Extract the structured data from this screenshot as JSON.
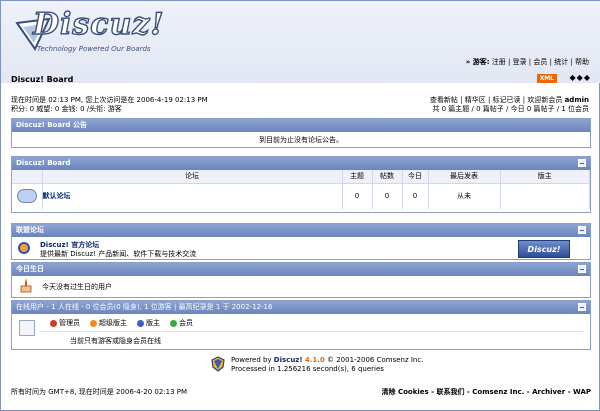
{
  "header": {
    "logo_text": "Discuz!",
    "logo_tagline": "Technology Powered Our Boards",
    "toplinks_prefix": "» 游客:",
    "toplinks": "注册 | 登录 | 会员 | 统计 | 帮助",
    "board_title": "Discuz! Board",
    "xml_label": "XML",
    "arrows": "◆◆◆"
  },
  "info": {
    "left_line1": "现在时间是 02:13 PM, 您上次访问是在 2006-4-19 02:13 PM",
    "left_line2": "积分: 0 威望: 0 金钱: 0 /头衔: 游客",
    "right_line1_links": "查看新帖 | 精华区 | 标记已读 | 欢迎新会员",
    "right_line1_user": "admin",
    "right_line2": "共 0 篇主题 / 0 篇帖子 / 今日 0 篇帖子 / 1 位会员"
  },
  "announce": {
    "title": "Discuz! Board 公告",
    "text": "到目前为止没有论坛公告。"
  },
  "forums": {
    "title": "Discuz! Board",
    "columns": [
      "论坛",
      "主题",
      "帖数",
      "今日",
      "最后发表",
      "版主"
    ],
    "rows": [
      {
        "name": "默认论坛",
        "topics": "0",
        "posts": "0",
        "today": "0",
        "last": "从未",
        "mod": ""
      }
    ]
  },
  "league": {
    "title": "联盟论坛",
    "name": "Discuz! 官方论坛",
    "desc": "提供最新 Discuz! 产品新闻、软件下载与技术交流",
    "banner": "Discuz!"
  },
  "birthday": {
    "title": "今日生日",
    "text": "今天没有过生日的用户"
  },
  "online": {
    "title": "在线用户",
    "summary": "- 1 人在线 - 0 位会员(0 隐身), 1 位游客 | 最高纪录是 1 于 2002-12-16",
    "legend": [
      {
        "label": "管理员",
        "color": "#d23a2a"
      },
      {
        "label": "超级版主",
        "color": "#f08a1a"
      },
      {
        "label": "版主",
        "color": "#3a62c4"
      },
      {
        "label": "会员",
        "color": "#3aa83a"
      }
    ],
    "none_text": "当前只有游客或隐身会员在线"
  },
  "powered": {
    "line1_prefix": "Powered by ",
    "line1_brand": "Discuz!",
    "line1_version": "4.1.0",
    "line1_suffix": "© 2001-2006 Comsenz Inc.",
    "line2": "Processed in 1.256216 second(s), 6 queries"
  },
  "bottom": {
    "left": "所有时间为 GMT+8, 现在时间是 2006-4-20 02:13 PM",
    "right": "清除 Cookies - 联系我们 - Comsenz Inc. - Archiver - WAP"
  }
}
